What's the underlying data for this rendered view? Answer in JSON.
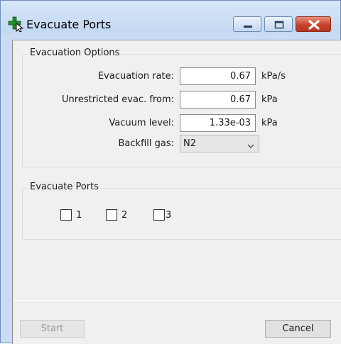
{
  "window": {
    "title": "Evacuate Ports",
    "title_icon": "plus-arrow-icon"
  },
  "evacuation_options": {
    "group_title": "Evacuation Options",
    "rate": {
      "label": "Evacuation rate:",
      "value": "0.67",
      "unit": "kPa/s"
    },
    "unrestricted": {
      "label": "Unrestricted evac. from:",
      "value": "0.67",
      "unit": "kPa"
    },
    "vacuum": {
      "label": "Vacuum level:",
      "value": "1.33e-03",
      "unit": "kPa"
    },
    "backfill": {
      "label": "Backfill gas:",
      "value": "N2"
    }
  },
  "evacuate_ports": {
    "group_title": "Evacuate Ports",
    "ports": [
      {
        "label": "1",
        "checked": false
      },
      {
        "label": "2",
        "checked": false
      },
      {
        "label": "3",
        "checked": false
      }
    ]
  },
  "buttons": {
    "start": "Start",
    "cancel": "Cancel"
  },
  "colors": {
    "title_bar": "#c9dcf3",
    "close_button": "#c8432e",
    "client_bg": "#f0f0f0"
  }
}
